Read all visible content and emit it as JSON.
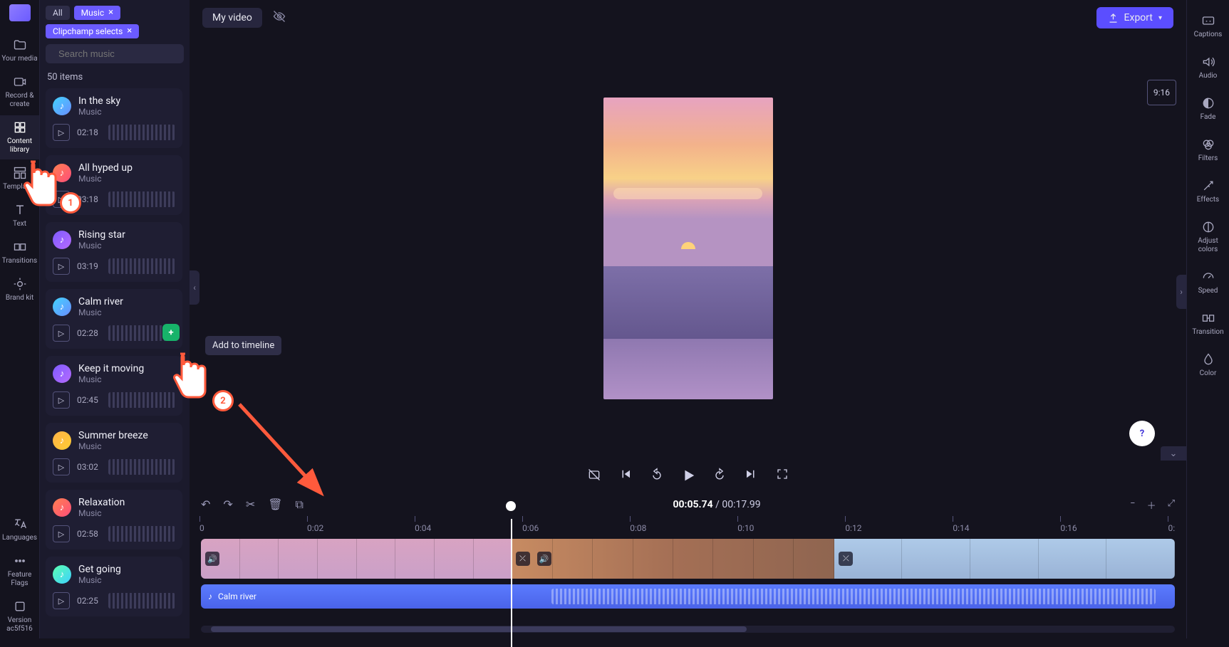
{
  "left_rail": {
    "items": [
      {
        "label": "Your media"
      },
      {
        "label": "Record & create"
      },
      {
        "label": "Content library"
      },
      {
        "label": "Templates"
      },
      {
        "label": "Text"
      },
      {
        "label": "Transitions"
      },
      {
        "label": "Brand kit"
      }
    ],
    "bottom": [
      {
        "label": "Languages"
      },
      {
        "label": "Feature Flags"
      },
      {
        "label": "Version ac5f516"
      }
    ]
  },
  "panel": {
    "chips": {
      "all": "All",
      "music": "Music",
      "selects": "Clipchamp selects"
    },
    "search_placeholder": "Search music",
    "count": "50 items",
    "tracks": [
      {
        "title": "In the sky",
        "sub": "Music",
        "dur": "02:18"
      },
      {
        "title": "All hyped up",
        "sub": "Music",
        "dur": "03:18"
      },
      {
        "title": "Rising star",
        "sub": "Music",
        "dur": "03:19"
      },
      {
        "title": "Calm river",
        "sub": "Music",
        "dur": "02:28",
        "add": true
      },
      {
        "title": "Keep it moving",
        "sub": "Music",
        "dur": "02:45"
      },
      {
        "title": "Summer breeze",
        "sub": "Music",
        "dur": "03:02"
      },
      {
        "title": "Relaxation",
        "sub": "Music",
        "dur": "02:58"
      },
      {
        "title": "Get going",
        "sub": "Music",
        "dur": "02:25"
      }
    ]
  },
  "tooltip": "Add to timeline",
  "topbar": {
    "title": "My video",
    "export": "Export",
    "duration": "9:16"
  },
  "timecode": {
    "current": "00:05.74",
    "total": "00:17.99"
  },
  "ruler": [
    "0",
    "0:02",
    "0:04",
    "0:06",
    "0:08",
    "0:10",
    "0:12",
    "0:14",
    "0:16",
    "0:"
  ],
  "timeline": {
    "audio_title": "Calm river"
  },
  "right_rail": [
    {
      "label": "Captions"
    },
    {
      "label": "Audio"
    },
    {
      "label": "Fade"
    },
    {
      "label": "Filters"
    },
    {
      "label": "Effects"
    },
    {
      "label": "Adjust colors"
    },
    {
      "label": "Speed"
    },
    {
      "label": "Transition"
    },
    {
      "label": "Color"
    }
  ],
  "annotations": {
    "badge1": "1",
    "badge2": "2"
  }
}
